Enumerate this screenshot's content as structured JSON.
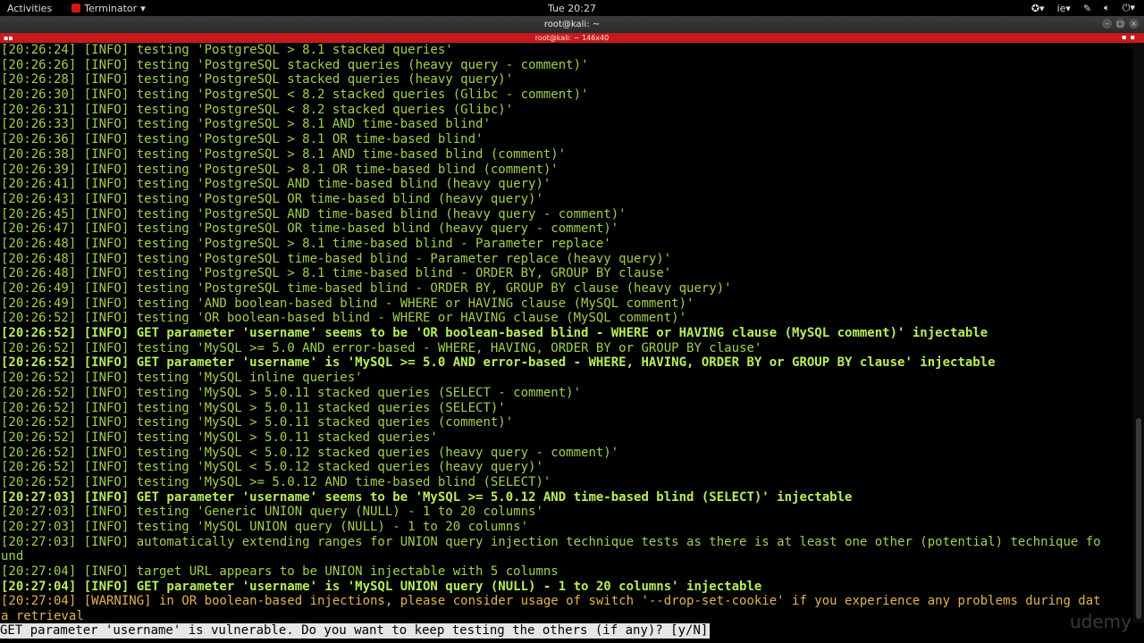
{
  "system_bar": {
    "activities": "Activities",
    "app_name": "Terminator",
    "clock": "Tue 20:27",
    "lang": "ie",
    "icons": [
      "accessibility-icon",
      "keyboard-icon",
      "pen-icon",
      "volume-icon",
      "power-icon"
    ]
  },
  "window": {
    "title": "root@kali: ~",
    "term_title": "root@kali: ~ 146x40"
  },
  "terminal": {
    "lines": [
      {
        "t": "[20:26:24] [INFO] testing 'PostgreSQL > 8.1 stacked queries'",
        "s": "info"
      },
      {
        "t": "[20:26:26] [INFO] testing 'PostgreSQL stacked queries (heavy query - comment)'",
        "s": "info"
      },
      {
        "t": "[20:26:28] [INFO] testing 'PostgreSQL stacked queries (heavy query)'",
        "s": "info"
      },
      {
        "t": "[20:26:30] [INFO] testing 'PostgreSQL < 8.2 stacked queries (Glibc - comment)'",
        "s": "info"
      },
      {
        "t": "[20:26:31] [INFO] testing 'PostgreSQL < 8.2 stacked queries (Glibc)'",
        "s": "info"
      },
      {
        "t": "[20:26:33] [INFO] testing 'PostgreSQL > 8.1 AND time-based blind'",
        "s": "info"
      },
      {
        "t": "[20:26:36] [INFO] testing 'PostgreSQL > 8.1 OR time-based blind'",
        "s": "info"
      },
      {
        "t": "[20:26:38] [INFO] testing 'PostgreSQL > 8.1 AND time-based blind (comment)'",
        "s": "info"
      },
      {
        "t": "[20:26:39] [INFO] testing 'PostgreSQL > 8.1 OR time-based blind (comment)'",
        "s": "info"
      },
      {
        "t": "[20:26:41] [INFO] testing 'PostgreSQL AND time-based blind (heavy query)'",
        "s": "info"
      },
      {
        "t": "[20:26:43] [INFO] testing 'PostgreSQL OR time-based blind (heavy query)'",
        "s": "info"
      },
      {
        "t": "[20:26:45] [INFO] testing 'PostgreSQL AND time-based blind (heavy query - comment)'",
        "s": "info"
      },
      {
        "t": "[20:26:47] [INFO] testing 'PostgreSQL OR time-based blind (heavy query - comment)'",
        "s": "info"
      },
      {
        "t": "[20:26:48] [INFO] testing 'PostgreSQL > 8.1 time-based blind - Parameter replace'",
        "s": "info"
      },
      {
        "t": "[20:26:48] [INFO] testing 'PostgreSQL time-based blind - Parameter replace (heavy query)'",
        "s": "info"
      },
      {
        "t": "[20:26:48] [INFO] testing 'PostgreSQL > 8.1 time-based blind - ORDER BY, GROUP BY clause'",
        "s": "info"
      },
      {
        "t": "[20:26:49] [INFO] testing 'PostgreSQL time-based blind - ORDER BY, GROUP BY clause (heavy query)'",
        "s": "info"
      },
      {
        "t": "[20:26:49] [INFO] testing 'AND boolean-based blind - WHERE or HAVING clause (MySQL comment)'",
        "s": "info"
      },
      {
        "t": "[20:26:52] [INFO] testing 'OR boolean-based blind - WHERE or HAVING clause (MySQL comment)'",
        "s": "info"
      },
      {
        "t": "[20:26:52] [INFO] GET parameter 'username' seems to be 'OR boolean-based blind - WHERE or HAVING clause (MySQL comment)' injectable",
        "s": "bold"
      },
      {
        "t": "[20:26:52] [INFO] testing 'MySQL >= 5.0 AND error-based - WHERE, HAVING, ORDER BY or GROUP BY clause'",
        "s": "info"
      },
      {
        "t": "[20:26:52] [INFO] GET parameter 'username' is 'MySQL >= 5.0 AND error-based - WHERE, HAVING, ORDER BY or GROUP BY clause' injectable",
        "s": "bold"
      },
      {
        "t": "[20:26:52] [INFO] testing 'MySQL inline queries'",
        "s": "info"
      },
      {
        "t": "[20:26:52] [INFO] testing 'MySQL > 5.0.11 stacked queries (SELECT - comment)'",
        "s": "info"
      },
      {
        "t": "[20:26:52] [INFO] testing 'MySQL > 5.0.11 stacked queries (SELECT)'",
        "s": "info"
      },
      {
        "t": "[20:26:52] [INFO] testing 'MySQL > 5.0.11 stacked queries (comment)'",
        "s": "info"
      },
      {
        "t": "[20:26:52] [INFO] testing 'MySQL > 5.0.11 stacked queries'",
        "s": "info"
      },
      {
        "t": "[20:26:52] [INFO] testing 'MySQL < 5.0.12 stacked queries (heavy query - comment)'",
        "s": "info"
      },
      {
        "t": "[20:26:52] [INFO] testing 'MySQL < 5.0.12 stacked queries (heavy query)'",
        "s": "info"
      },
      {
        "t": "[20:26:52] [INFO] testing 'MySQL >= 5.0.12 AND time-based blind (SELECT)'",
        "s": "info"
      },
      {
        "t": "[20:27:03] [INFO] GET parameter 'username' seems to be 'MySQL >= 5.0.12 AND time-based blind (SELECT)' injectable",
        "s": "bold"
      },
      {
        "t": "[20:27:03] [INFO] testing 'Generic UNION query (NULL) - 1 to 20 columns'",
        "s": "info"
      },
      {
        "t": "[20:27:03] [INFO] testing 'MySQL UNION query (NULL) - 1 to 20 columns'",
        "s": "info"
      },
      {
        "t": "[20:27:03] [INFO] automatically extending ranges for UNION query injection technique tests as there is at least one other (potential) technique fo",
        "s": "info"
      },
      {
        "t": "und",
        "s": "info"
      },
      {
        "t": "[20:27:04] [INFO] target URL appears to be UNION injectable with 5 columns",
        "s": "info"
      },
      {
        "t": "[20:27:04] [INFO] GET parameter 'username' is 'MySQL UNION query (NULL) - 1 to 20 columns' injectable",
        "s": "bold"
      },
      {
        "t": "[20:27:04] [WARNING] in OR boolean-based injections, please consider usage of switch '--drop-set-cookie' if you experience any problems during dat",
        "s": "warn"
      },
      {
        "t": "a retrieval",
        "s": "warn"
      }
    ],
    "prompt": "GET parameter 'username' is vulnerable. Do you want to keep testing the others (if any)? [y/N]"
  },
  "watermark": "udemy",
  "colors": {
    "info": "#9fd14d",
    "bold": "#b7ee5a",
    "warn": "#e0b44c",
    "termbar": "#c8191c"
  }
}
